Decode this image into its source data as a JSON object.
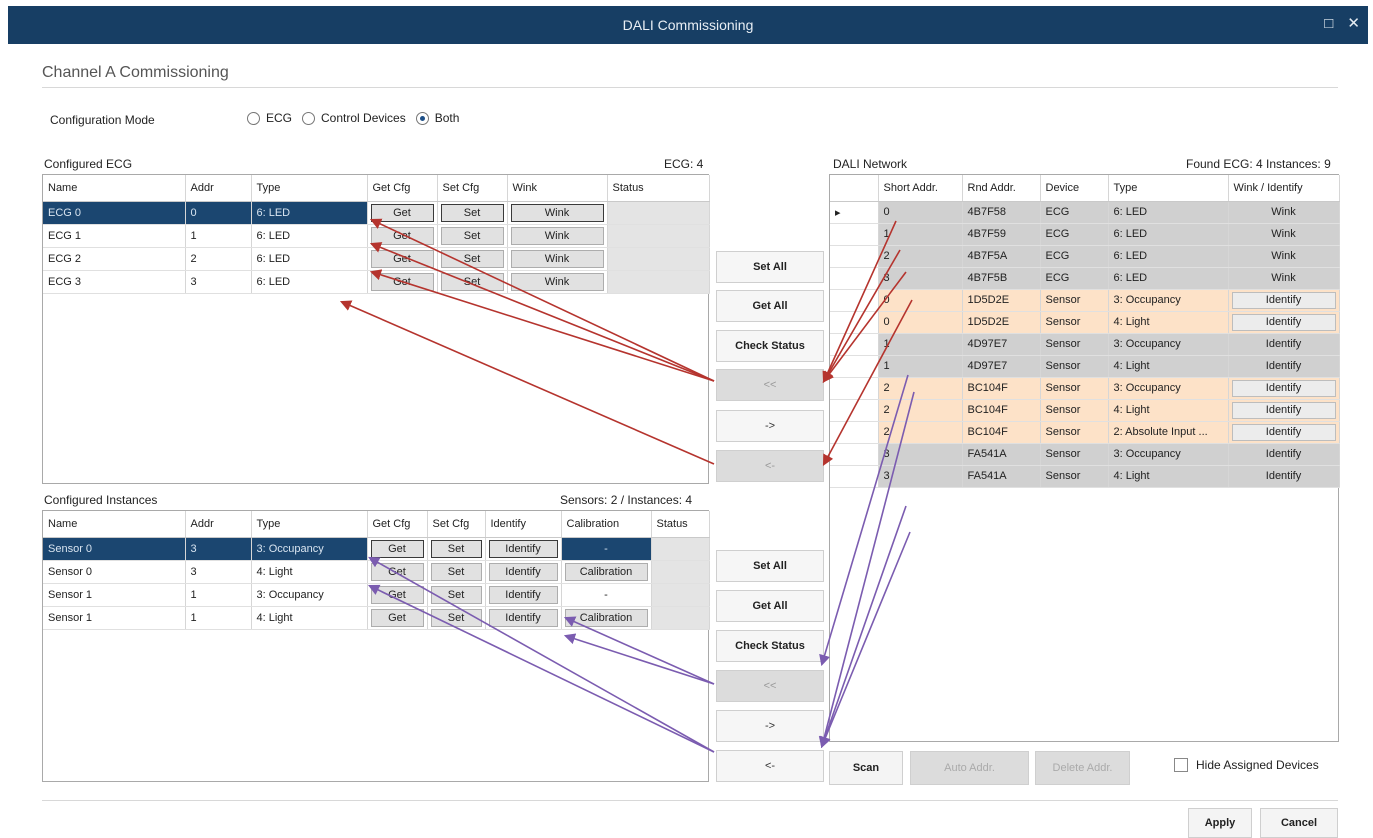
{
  "window": {
    "title": "DALI Commissioning",
    "maximize_icon": "maximize-icon",
    "close_icon": "close-icon"
  },
  "section_title": "Channel A Commissioning",
  "config_mode": {
    "label": "Configuration Mode",
    "options": [
      {
        "label": "ECG",
        "checked": false
      },
      {
        "label": "Control Devices",
        "checked": false
      },
      {
        "label": "Both",
        "checked": true
      }
    ]
  },
  "configured_ecg": {
    "title": "Configured ECG",
    "count": "ECG: 4",
    "columns": [
      "Name",
      "Addr",
      "Type",
      "Get Cfg",
      "Set Cfg",
      "Wink",
      "Status"
    ],
    "rows": [
      {
        "name": "ECG 0",
        "addr": "0",
        "type": "6: LED",
        "get": "Get",
        "set": "Set",
        "wink": "Wink"
      },
      {
        "name": "ECG 1",
        "addr": "1",
        "type": "6: LED",
        "get": "Get",
        "set": "Set",
        "wink": "Wink"
      },
      {
        "name": "ECG 2",
        "addr": "2",
        "type": "6: LED",
        "get": "Get",
        "set": "Set",
        "wink": "Wink"
      },
      {
        "name": "ECG 3",
        "addr": "3",
        "type": "6: LED",
        "get": "Get",
        "set": "Set",
        "wink": "Wink"
      }
    ]
  },
  "configured_instances": {
    "title": "Configured Instances",
    "count": "Sensors: 2 / Instances: 4",
    "columns": [
      "Name",
      "Addr",
      "Type",
      "Get Cfg",
      "Set Cfg",
      "Identify",
      "Calibration",
      "Status"
    ],
    "rows": [
      {
        "name": "Sensor 0",
        "addr": "3",
        "type": "3: Occupancy",
        "get": "Get",
        "set": "Set",
        "identify": "Identify",
        "calibration": "-"
      },
      {
        "name": "Sensor 0",
        "addr": "3",
        "type": "4: Light",
        "get": "Get",
        "set": "Set",
        "identify": "Identify",
        "calibration": "Calibration"
      },
      {
        "name": "Sensor 1",
        "addr": "1",
        "type": "3: Occupancy",
        "get": "Get",
        "set": "Set",
        "identify": "Identify",
        "calibration": "-"
      },
      {
        "name": "Sensor 1",
        "addr": "1",
        "type": "4: Light",
        "get": "Get",
        "set": "Set",
        "identify": "Identify",
        "calibration": "Calibration"
      }
    ]
  },
  "ecg_buttons": {
    "set_all": "Set All",
    "get_all": "Get All",
    "check_status": "Check Status",
    "move_all_left": "<<",
    "move_right": "->",
    "move_left": "<-"
  },
  "inst_buttons": {
    "set_all": "Set All",
    "get_all": "Get All",
    "check_status": "Check Status",
    "move_all_left": "<<",
    "move_right": "->",
    "move_left": "<-"
  },
  "dali_network": {
    "title": "DALI Network",
    "count": "Found ECG: 4 Instances: 9",
    "columns": [
      "Short Addr.",
      "Rnd Addr.",
      "Device",
      "Type",
      "Wink / Identify"
    ],
    "current_row_marker": "▸",
    "rows": [
      {
        "short": "0",
        "rnd": "4B7F58",
        "device": "ECG",
        "type": "6: LED",
        "action": "Wink",
        "style": "gray"
      },
      {
        "short": "1",
        "rnd": "4B7F59",
        "device": "ECG",
        "type": "6: LED",
        "action": "Wink",
        "style": "gray"
      },
      {
        "short": "2",
        "rnd": "4B7F5A",
        "device": "ECG",
        "type": "6: LED",
        "action": "Wink",
        "style": "gray"
      },
      {
        "short": "3",
        "rnd": "4B7F5B",
        "device": "ECG",
        "type": "6: LED",
        "action": "Wink",
        "style": "gray"
      },
      {
        "short": "0",
        "rnd": "1D5D2E",
        "device": "Sensor",
        "type": "3: Occupancy",
        "action": "Identify",
        "style": "orange"
      },
      {
        "short": "0",
        "rnd": "1D5D2E",
        "device": "Sensor",
        "type": "4: Light",
        "action": "Identify",
        "style": "orange"
      },
      {
        "short": "1",
        "rnd": "4D97E7",
        "device": "Sensor",
        "type": "3: Occupancy",
        "action": "Identify",
        "style": "gray"
      },
      {
        "short": "1",
        "rnd": "4D97E7",
        "device": "Sensor",
        "type": "4: Light",
        "action": "Identify",
        "style": "gray"
      },
      {
        "short": "2",
        "rnd": "BC104F",
        "device": "Sensor",
        "type": "3: Occupancy",
        "action": "Identify",
        "style": "orange"
      },
      {
        "short": "2",
        "rnd": "BC104F",
        "device": "Sensor",
        "type": "4: Light",
        "action": "Identify",
        "style": "orange"
      },
      {
        "short": "2",
        "rnd": "BC104F",
        "device": "Sensor",
        "type": "2: Absolute Input ...",
        "action": "Identify",
        "style": "orange"
      },
      {
        "short": "3",
        "rnd": "FA541A",
        "device": "Sensor",
        "type": "3: Occupancy",
        "action": "Identify",
        "style": "gray"
      },
      {
        "short": "3",
        "rnd": "FA541A",
        "device": "Sensor",
        "type": "4: Light",
        "action": "Identify",
        "style": "gray"
      }
    ]
  },
  "network_buttons": {
    "scan": "Scan",
    "auto_addr": "Auto Addr.",
    "delete_addr": "Delete Addr."
  },
  "hide_assigned": {
    "label": "Hide Assigned Devices",
    "checked": false
  },
  "footer": {
    "apply": "Apply",
    "cancel": "Cancel"
  },
  "colors": {
    "titlebar": "#173e64",
    "selection": "#1b4670",
    "sensor_row": "#fde2c8",
    "ecg_row": "#d0d0d0",
    "arrow_red": "#b5342e",
    "arrow_purple": "#7b5cb0"
  }
}
